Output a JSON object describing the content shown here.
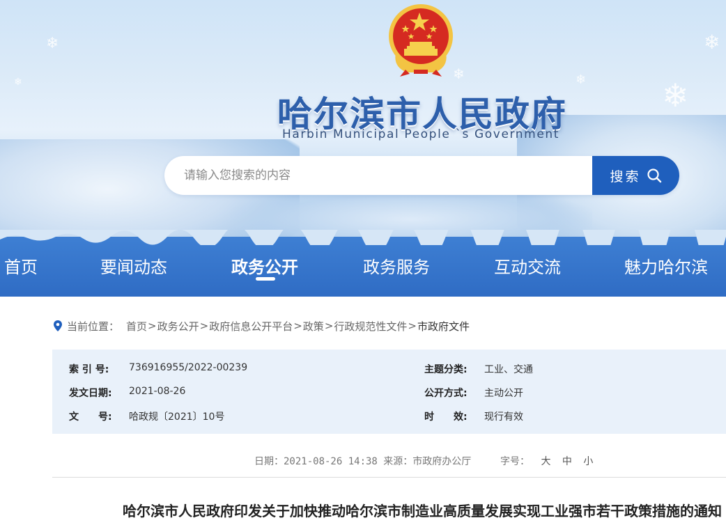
{
  "header": {
    "site_title": "哈尔滨市人民政府",
    "site_subtitle": "Harbin Municipal People `s Government",
    "emblem_icon": "national-emblem-icon"
  },
  "search": {
    "placeholder": "请输入您搜索的内容",
    "button_label": "搜索",
    "button_icon": "search-icon"
  },
  "nav": {
    "items": [
      {
        "label": "首页"
      },
      {
        "label": "要闻动态"
      },
      {
        "label": "政务公开"
      },
      {
        "label": "政务服务"
      },
      {
        "label": "互动交流"
      },
      {
        "label": "魅力哈尔滨"
      }
    ],
    "active": "政务公开"
  },
  "breadcrumb": {
    "icon": "location-pin-icon",
    "label": "当前位置：",
    "items": [
      "首页",
      "政务公开",
      "政府信息公开平台",
      "政策",
      "行政规范性文件",
      "市政府文件"
    ],
    "separator": ">"
  },
  "info": {
    "index_no_key": "索 引 号:",
    "index_no_val": "736916955/2022-00239",
    "date_key": "发文日期:",
    "date_val": "2021-08-26",
    "doc_no_key": "文　　号:",
    "doc_no_val": "哈政规〔2021〕10号",
    "topic_key": "主题分类:",
    "topic_val": "工业、交通",
    "public_key": "公开方式:",
    "public_val": "主动公开",
    "validity_key": "时　　效:",
    "validity_val": "现行有效"
  },
  "meta": {
    "line": "日期：2021-08-26 14:38 来源：市政府办公厅",
    "fontsize_label": "字号：",
    "fontsize_options": [
      "大",
      "中",
      "小"
    ]
  },
  "document": {
    "title": "哈尔滨市人民政府印发关于加快推动哈尔滨市制造业高质量发展实现工业强市若干政策措施的通知"
  },
  "colors": {
    "brand_blue": "#2f6cc4",
    "title_blue": "#2d5fab",
    "info_bg": "#e9f1fa",
    "emblem_red": "#d52a21",
    "emblem_gold": "#f3c443"
  }
}
